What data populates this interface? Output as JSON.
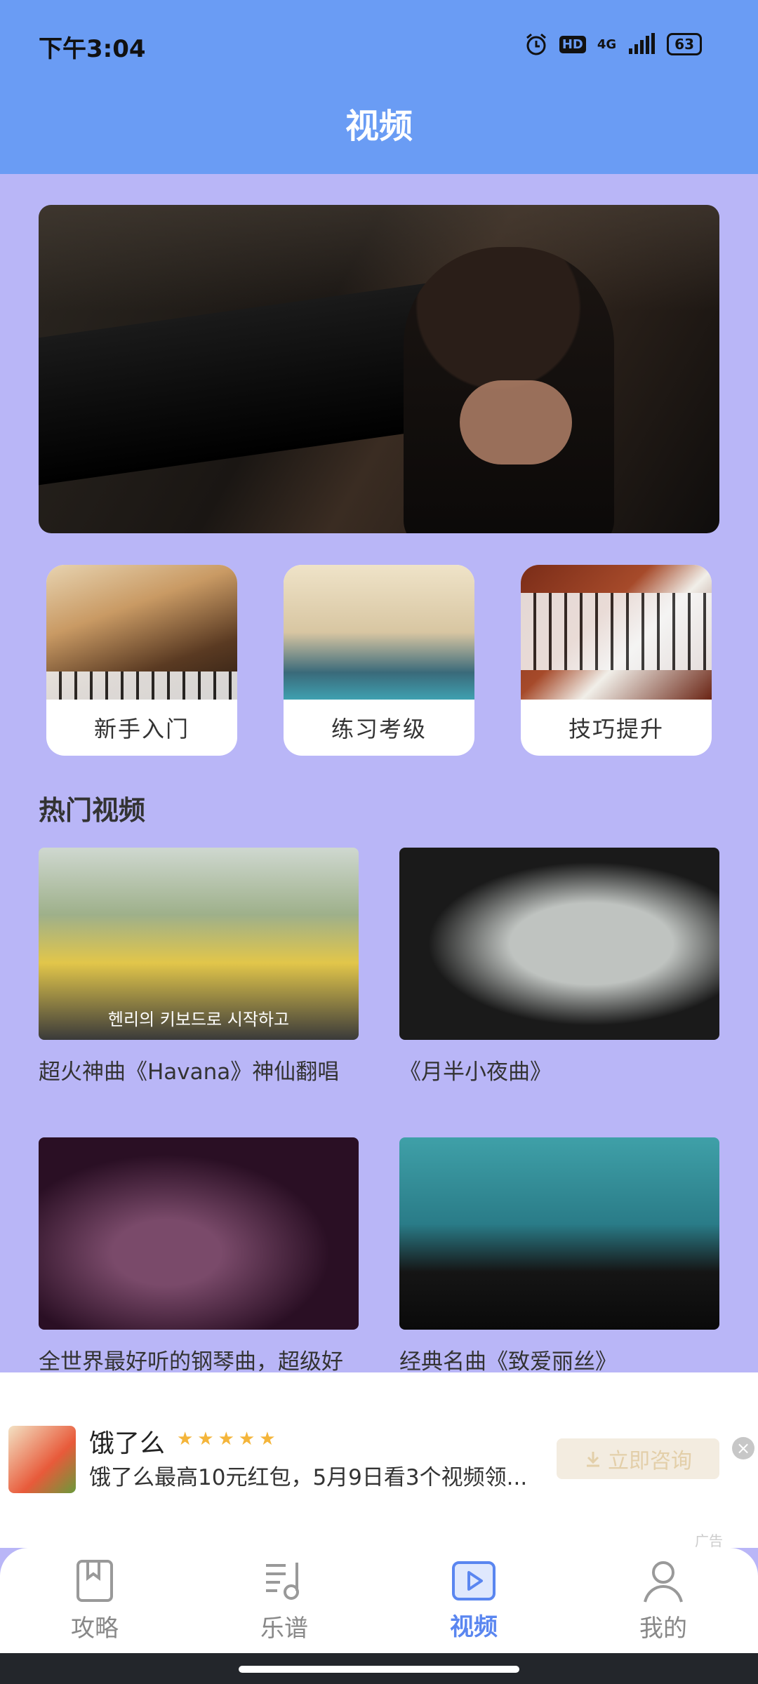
{
  "status": {
    "time": "下午3:04",
    "battery": "63",
    "net": "4G",
    "hd": "HD"
  },
  "header": {
    "title": "视频"
  },
  "categories": [
    {
      "label": "新手入门"
    },
    {
      "label": "练习考级"
    },
    {
      "label": "技巧提升"
    }
  ],
  "section": {
    "title": "热门视频"
  },
  "videos": [
    {
      "caption": "超火神曲《Havana》神仙翻唱",
      "subtitle": "헨리의 키보드로 시작하고"
    },
    {
      "caption": "《月半小夜曲》"
    },
    {
      "caption": "全世界最好听的钢琴曲，超级好"
    },
    {
      "caption": "经典名曲《致爱丽丝》"
    }
  ],
  "ad": {
    "title": "饿了么",
    "rating": "★★★★★",
    "description": "饿了么最高10元红包，5月9日看3个视频领...",
    "button": "立即咨询",
    "tag": "广告",
    "close": "×"
  },
  "nav": [
    {
      "label": "攻略",
      "icon": "book-icon"
    },
    {
      "label": "乐谱",
      "icon": "music-score-icon"
    },
    {
      "label": "视频",
      "icon": "video-icon",
      "active": true
    },
    {
      "label": "我的",
      "icon": "profile-icon"
    }
  ],
  "colors": {
    "header": "#6a9cf4",
    "background": "#b9b6f7",
    "accent": "#5a86f0"
  }
}
